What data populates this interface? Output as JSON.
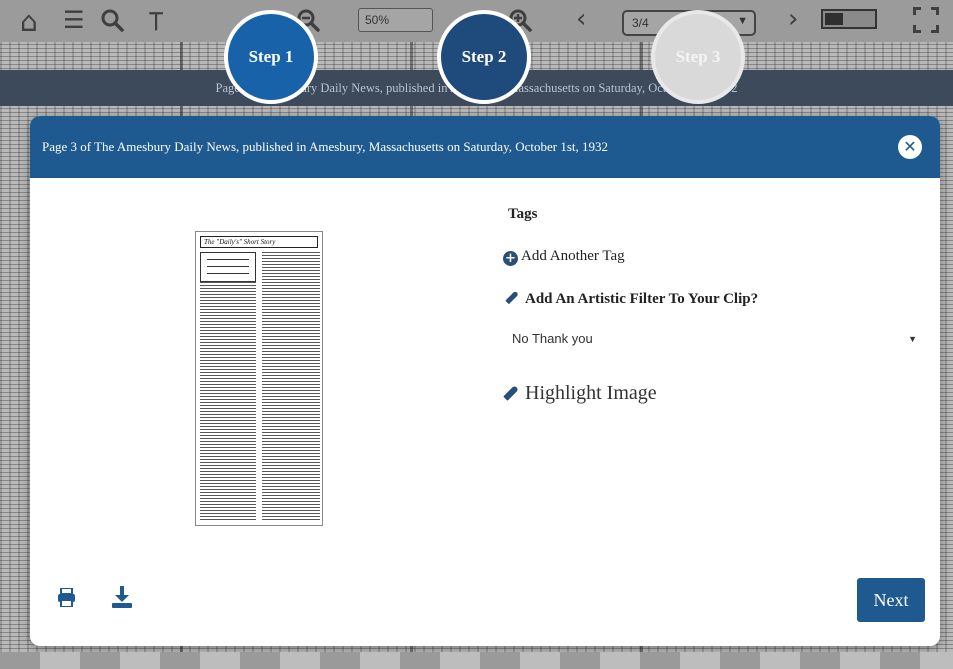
{
  "toolbar": {
    "zoom_value": "50%",
    "page_value": "3/4",
    "icons": [
      "home-icon",
      "list-icon",
      "search-icon",
      "crop-icon",
      "zoom-out-icon",
      "zoom-in-icon",
      "prev-icon",
      "next-icon",
      "contrast-toggle",
      "fullscreen-icon"
    ]
  },
  "caption_band": {
    "text": "Page 3 of Amesbury Daily News, published in Amesbury, Massachusetts on Saturday, October 1st, 1932"
  },
  "steps": [
    {
      "label": "Step 1",
      "state": "done"
    },
    {
      "label": "Step 2",
      "state": "active"
    },
    {
      "label": "Step 3",
      "state": "pending"
    }
  ],
  "modal": {
    "title": "Page 3 of The Amesbury Daily News, published in Amesbury, Massachusetts on Saturday, October 1st, 1932",
    "clip_title": "The \"Daily's\" Short Story",
    "tags_heading": "Tags",
    "add_tag_label": "Add Another Tag",
    "filter_heading": "Add An Artistic Filter To Your Clip?",
    "filter_value": "No Thank you",
    "highlight_label": "Highlight Image",
    "next_label": "Next"
  },
  "colors": {
    "accent": "#1e5990",
    "step_done": "#1762a8",
    "step_active": "#1f4a7c"
  }
}
